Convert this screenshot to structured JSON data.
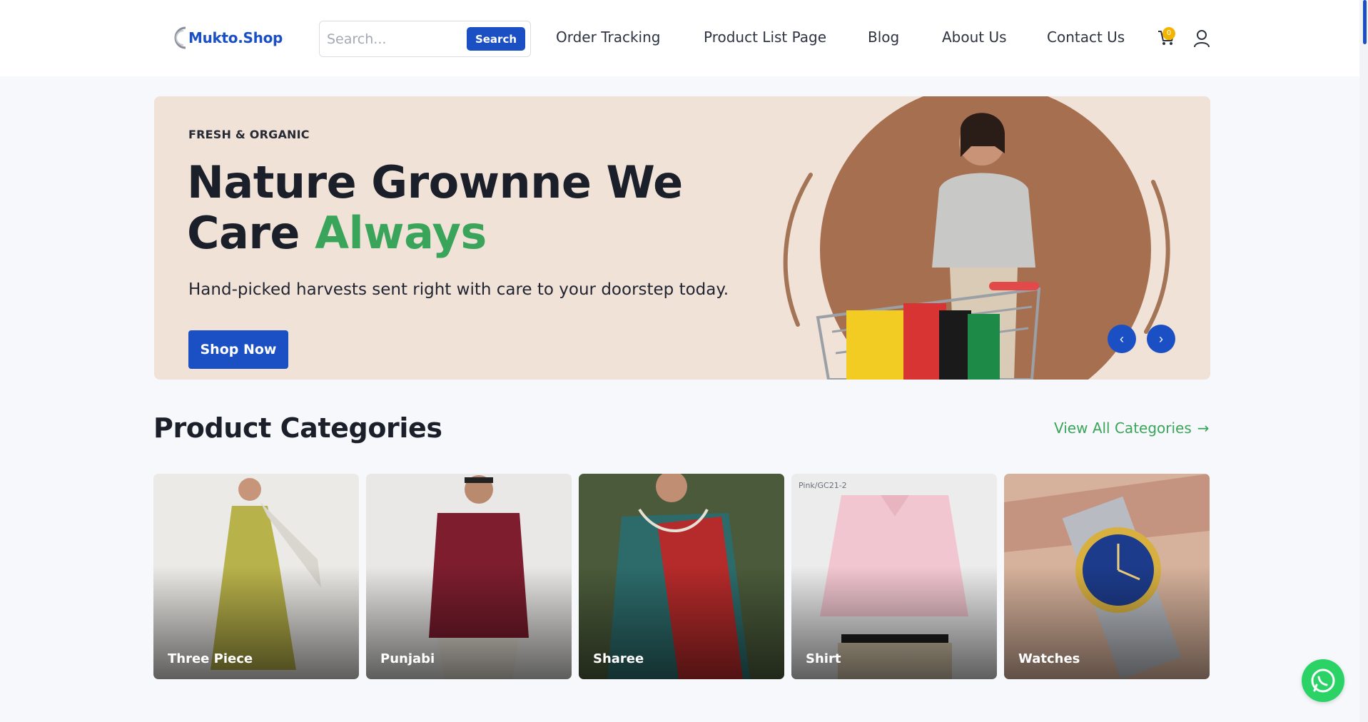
{
  "header": {
    "logo_text": "Mukto.Shop",
    "search": {
      "placeholder": "Search...",
      "button_label": "Search"
    },
    "nav": [
      "Order Tracking",
      "Product List Page",
      "Blog",
      "About Us",
      "Contact Us"
    ],
    "cart_count": "0",
    "icons": {
      "cart": "cart-icon",
      "user": "user-icon"
    }
  },
  "hero": {
    "kicker": "FRESH & ORGANIC",
    "title_line1": "Nature Grownne We",
    "title_line2_plain": "Care",
    "title_line2_accent": "Always",
    "subtitle": "Hand-picked harvests sent right with care to your doorstep today.",
    "cta_label": "Shop Now",
    "prev_glyph": "‹",
    "next_glyph": "›"
  },
  "categories": {
    "title": "Product Categories",
    "view_all_label": "View All Categories",
    "view_all_arrow": "→",
    "items": [
      {
        "label": "Three Piece"
      },
      {
        "label": "Punjabi"
      },
      {
        "label": "Sharee"
      },
      {
        "label": "Shirt",
        "tag": "Pink/GC21-2"
      },
      {
        "label": "Watches"
      }
    ]
  },
  "colors": {
    "brand_blue": "#1b4fc4",
    "accent_green": "#3aa55a",
    "hero_bg": "#f1e2d8",
    "whatsapp_green": "#2bd366"
  },
  "floating": {
    "whatsapp_icon": "whatsapp-icon"
  }
}
